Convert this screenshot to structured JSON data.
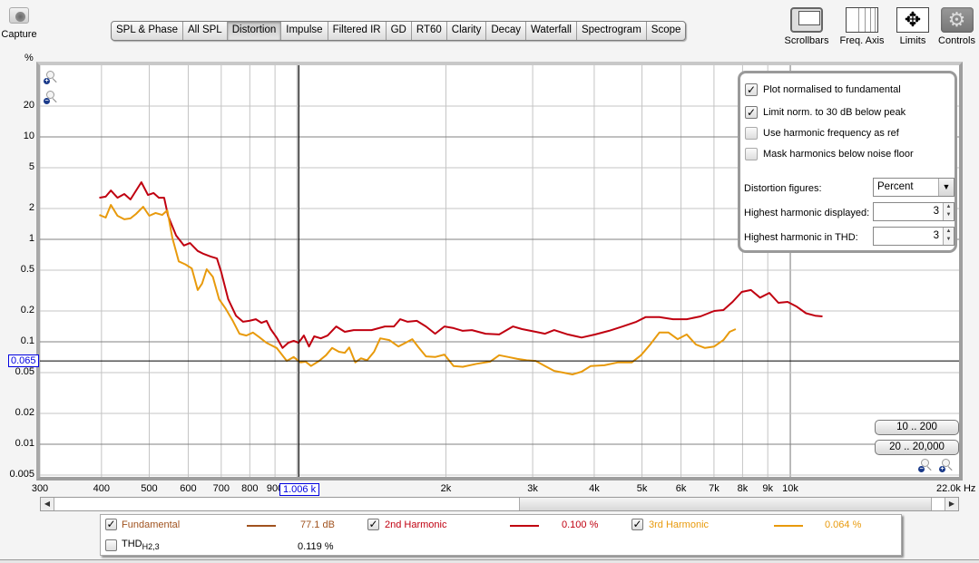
{
  "toolbar": {
    "capture_label": "Capture",
    "tabs": [
      "SPL & Phase",
      "All SPL",
      "Distortion",
      "Impulse",
      "Filtered IR",
      "GD",
      "RT60",
      "Clarity",
      "Decay",
      "Waterfall",
      "Spectrogram",
      "Scope"
    ],
    "active_tab": "Distortion",
    "tools": {
      "scrollbars": "Scrollbars",
      "freq_axis": "Freq. Axis",
      "limits": "Limits",
      "controls": "Controls"
    }
  },
  "plot": {
    "y_unit": "%",
    "x_unit_end": "22.0k Hz",
    "y_cursor": "0.065",
    "x_cursor": "1.006 k"
  },
  "controls_panel": {
    "checkboxes": [
      {
        "label": "Plot normalised to fundamental",
        "checked": true
      },
      {
        "label": "Limit norm. to 30 dB below peak",
        "checked": true
      },
      {
        "label": "Use harmonic frequency as ref",
        "checked": false
      },
      {
        "label": "Mask harmonics below noise floor",
        "checked": false
      }
    ],
    "distortion_figures_label": "Distortion figures:",
    "distortion_figures_value": "Percent",
    "highest_displayed_label": "Highest harmonic displayed:",
    "highest_displayed_value": "3",
    "highest_thd_label": "Highest harmonic in THD:",
    "highest_thd_value": "3"
  },
  "range_buttons": [
    "10 .. 200",
    "20 .. 20,000"
  ],
  "legend": {
    "fundamental": {
      "label": "Fundamental",
      "value": "77.1 dB",
      "checked": true,
      "color": "#a0521e"
    },
    "h2": {
      "label": "2nd Harmonic",
      "value": "0.100 %",
      "checked": true,
      "color": "#c00010"
    },
    "h3": {
      "label": "3rd Harmonic",
      "value": "0.064 %",
      "checked": true,
      "color": "#e89a0c"
    },
    "thd": {
      "label": "THD",
      "sub": "H2,3",
      "value": "0.119 %",
      "checked": false
    }
  },
  "chart_data": {
    "type": "line",
    "title": "Distortion",
    "xlabel": "Hz",
    "ylabel": "%",
    "xscale": "log",
    "yscale": "log",
    "xlim": [
      300,
      22000
    ],
    "ylim": [
      0.0045,
      50
    ],
    "x_ticks": [
      {
        "v": 300,
        "label": "300"
      },
      {
        "v": 400,
        "label": "400"
      },
      {
        "v": 500,
        "label": "500"
      },
      {
        "v": 600,
        "label": "600"
      },
      {
        "v": 700,
        "label": "700"
      },
      {
        "v": 800,
        "label": "800"
      },
      {
        "v": 900,
        "label": "900"
      },
      {
        "v": 2000,
        "label": "2k"
      },
      {
        "v": 3000,
        "label": "3k"
      },
      {
        "v": 4000,
        "label": "4k"
      },
      {
        "v": 5000,
        "label": "5k"
      },
      {
        "v": 6000,
        "label": "6k"
      },
      {
        "v": 7000,
        "label": "7k"
      },
      {
        "v": 8000,
        "label": "8k"
      },
      {
        "v": 9000,
        "label": "9k"
      },
      {
        "v": 10000,
        "label": "10k"
      }
    ],
    "y_ticks": [
      {
        "v": 20,
        "label": "20"
      },
      {
        "v": 10,
        "label": "10"
      },
      {
        "v": 5,
        "label": "5"
      },
      {
        "v": 2,
        "label": "2"
      },
      {
        "v": 1,
        "label": "1"
      },
      {
        "v": 0.5,
        "label": "0.5"
      },
      {
        "v": 0.2,
        "label": "0.2"
      },
      {
        "v": 0.1,
        "label": "0.1"
      },
      {
        "v": 0.05,
        "label": "0.05"
      },
      {
        "v": 0.02,
        "label": "0.02"
      },
      {
        "v": 0.01,
        "label": "0.01"
      },
      {
        "v": 0.005,
        "label": "0.005"
      }
    ],
    "major_y": [
      10,
      1,
      0.1,
      0.01
    ],
    "major_x": [
      1000,
      10000
    ],
    "cursor": {
      "x": 1006,
      "y": 0.065
    },
    "grid": true,
    "series": [
      {
        "name": "2nd Harmonic",
        "color": "#c00010",
        "points": [
          [
            396,
            2.55
          ],
          [
            408,
            2.61
          ],
          [
            418,
            3.0
          ],
          [
            431,
            2.55
          ],
          [
            445,
            2.77
          ],
          [
            458,
            2.45
          ],
          [
            482,
            3.61
          ],
          [
            497,
            2.71
          ],
          [
            510,
            2.83
          ],
          [
            523,
            2.55
          ],
          [
            536,
            2.55
          ],
          [
            546,
            1.7
          ],
          [
            567,
            1.09
          ],
          [
            588,
            0.87
          ],
          [
            605,
            0.92
          ],
          [
            627,
            0.77
          ],
          [
            645,
            0.72
          ],
          [
            666,
            0.68
          ],
          [
            686,
            0.65
          ],
          [
            700,
            0.48
          ],
          [
            723,
            0.26
          ],
          [
            750,
            0.18
          ],
          [
            775,
            0.157
          ],
          [
            798,
            0.16
          ],
          [
            823,
            0.166
          ],
          [
            845,
            0.153
          ],
          [
            865,
            0.16
          ],
          [
            882,
            0.133
          ],
          [
            907,
            0.11
          ],
          [
            932,
            0.087
          ],
          [
            958,
            0.098
          ],
          [
            982,
            0.102
          ],
          [
            1005,
            0.098
          ],
          [
            1030,
            0.115
          ],
          [
            1055,
            0.09
          ],
          [
            1081,
            0.113
          ],
          [
            1115,
            0.108
          ],
          [
            1151,
            0.115
          ],
          [
            1198,
            0.141
          ],
          [
            1247,
            0.125
          ],
          [
            1300,
            0.13
          ],
          [
            1356,
            0.13
          ],
          [
            1413,
            0.13
          ],
          [
            1504,
            0.141
          ],
          [
            1569,
            0.141
          ],
          [
            1615,
            0.166
          ],
          [
            1673,
            0.157
          ],
          [
            1746,
            0.16
          ],
          [
            1822,
            0.141
          ],
          [
            1902,
            0.12
          ],
          [
            1986,
            0.141
          ],
          [
            2073,
            0.136
          ],
          [
            2163,
            0.128
          ],
          [
            2258,
            0.13
          ],
          [
            2408,
            0.12
          ],
          [
            2566,
            0.118
          ],
          [
            2736,
            0.141
          ],
          [
            2855,
            0.133
          ],
          [
            3044,
            0.125
          ],
          [
            3178,
            0.12
          ],
          [
            3317,
            0.13
          ],
          [
            3536,
            0.118
          ],
          [
            3771,
            0.11
          ],
          [
            4020,
            0.118
          ],
          [
            4286,
            0.128
          ],
          [
            4570,
            0.141
          ],
          [
            4872,
            0.157
          ],
          [
            5085,
            0.174
          ],
          [
            5422,
            0.174
          ],
          [
            5781,
            0.166
          ],
          [
            6163,
            0.166
          ],
          [
            6572,
            0.177
          ],
          [
            7006,
            0.2
          ],
          [
            7314,
            0.204
          ],
          [
            7634,
            0.245
          ],
          [
            7969,
            0.307
          ],
          [
            8318,
            0.32
          ],
          [
            8683,
            0.27
          ],
          [
            9064,
            0.3
          ],
          [
            9460,
            0.24
          ],
          [
            9876,
            0.245
          ],
          [
            10308,
            0.22
          ],
          [
            10760,
            0.19
          ],
          [
            11232,
            0.18
          ],
          [
            11620,
            0.177
          ]
        ]
      },
      {
        "name": "3rd Harmonic",
        "color": "#e89a0c",
        "points": [
          [
            396,
            1.73
          ],
          [
            408,
            1.63
          ],
          [
            418,
            2.17
          ],
          [
            431,
            1.7
          ],
          [
            445,
            1.57
          ],
          [
            458,
            1.6
          ],
          [
            470,
            1.77
          ],
          [
            486,
            2.08
          ],
          [
            500,
            1.7
          ],
          [
            515,
            1.81
          ],
          [
            531,
            1.73
          ],
          [
            544,
            1.92
          ],
          [
            557,
            1.04
          ],
          [
            574,
            0.61
          ],
          [
            592,
            0.57
          ],
          [
            610,
            0.52
          ],
          [
            627,
            0.32
          ],
          [
            640,
            0.37
          ],
          [
            654,
            0.51
          ],
          [
            673,
            0.43
          ],
          [
            693,
            0.26
          ],
          [
            715,
            0.21
          ],
          [
            739,
            0.16
          ],
          [
            762,
            0.12
          ],
          [
            787,
            0.115
          ],
          [
            812,
            0.123
          ],
          [
            838,
            0.11
          ],
          [
            864,
            0.098
          ],
          [
            907,
            0.087
          ],
          [
            951,
            0.065
          ],
          [
            982,
            0.071
          ],
          [
            1013,
            0.063
          ],
          [
            1038,
            0.064
          ],
          [
            1065,
            0.058
          ],
          [
            1106,
            0.065
          ],
          [
            1142,
            0.074
          ],
          [
            1175,
            0.087
          ],
          [
            1213,
            0.08
          ],
          [
            1247,
            0.078
          ],
          [
            1273,
            0.088
          ],
          [
            1310,
            0.063
          ],
          [
            1345,
            0.069
          ],
          [
            1384,
            0.066
          ],
          [
            1430,
            0.08
          ],
          [
            1472,
            0.108
          ],
          [
            1535,
            0.104
          ],
          [
            1602,
            0.09
          ],
          [
            1658,
            0.098
          ],
          [
            1709,
            0.106
          ],
          [
            1761,
            0.088
          ],
          [
            1822,
            0.072
          ],
          [
            1902,
            0.071
          ],
          [
            1986,
            0.075
          ],
          [
            2073,
            0.058
          ],
          [
            2163,
            0.057
          ],
          [
            2308,
            0.061
          ],
          [
            2459,
            0.064
          ],
          [
            2566,
            0.074
          ],
          [
            2678,
            0.071
          ],
          [
            2795,
            0.068
          ],
          [
            2917,
            0.066
          ],
          [
            3044,
            0.065
          ],
          [
            3178,
            0.058
          ],
          [
            3317,
            0.052
          ],
          [
            3461,
            0.05
          ],
          [
            3612,
            0.048
          ],
          [
            3771,
            0.051
          ],
          [
            3935,
            0.058
          ],
          [
            4195,
            0.059
          ],
          [
            4472,
            0.063
          ],
          [
            4768,
            0.063
          ],
          [
            4977,
            0.074
          ],
          [
            5195,
            0.094
          ],
          [
            5422,
            0.123
          ],
          [
            5659,
            0.123
          ],
          [
            5906,
            0.106
          ],
          [
            6163,
            0.118
          ],
          [
            6432,
            0.094
          ],
          [
            6713,
            0.087
          ],
          [
            7006,
            0.09
          ],
          [
            7314,
            0.104
          ],
          [
            7533,
            0.125
          ],
          [
            7749,
            0.133
          ]
        ]
      }
    ]
  }
}
